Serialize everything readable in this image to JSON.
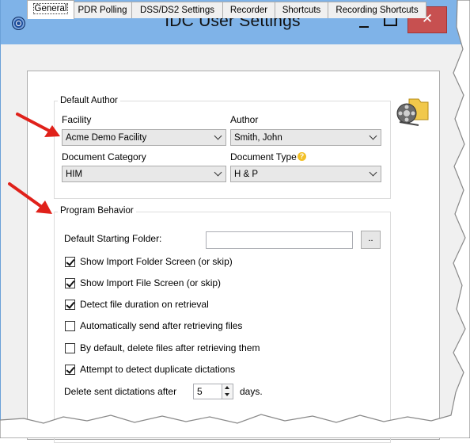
{
  "window": {
    "title": "IDC User Settings",
    "close_glyph": "✕",
    "accent_color": "#7fb3e8",
    "close_color": "#c75050"
  },
  "tabs": [
    {
      "label": "General",
      "active": true
    },
    {
      "label": "PDR Polling",
      "active": false
    },
    {
      "label": "DSS/DS2 Settings",
      "active": false
    },
    {
      "label": "Recorder",
      "active": false
    },
    {
      "label": "Shortcuts",
      "active": false
    },
    {
      "label": "Recording Shortcuts",
      "active": false
    }
  ],
  "default_author": {
    "legend": "Default Author",
    "facility_label": "Facility",
    "facility_value": "Acme Demo Facility",
    "author_label": "Author",
    "author_value": "Smith, John",
    "doc_category_label": "Document Category",
    "doc_category_value": "HIM",
    "doc_type_label": "Document Type",
    "doc_type_value": "H & P",
    "help_glyph": "?"
  },
  "program_behavior": {
    "legend": "Program Behavior",
    "starting_folder_label": "Default Starting Folder:",
    "starting_folder_value": "",
    "browse_label": "..",
    "checkboxes": [
      {
        "label": "Show Import Folder Screen (or skip)",
        "checked": true
      },
      {
        "label": "Show Import File Screen (or skip)",
        "checked": true
      },
      {
        "label": "Detect file duration on retrieval",
        "checked": true
      },
      {
        "label": "Automatically send after retrieving files",
        "checked": false
      },
      {
        "label": "By default, delete files after retrieving them",
        "checked": false
      },
      {
        "label": "Attempt to detect duplicate dictations",
        "checked": true
      }
    ],
    "delete_label": "Delete sent dictations after",
    "delete_value": "5",
    "delete_unit": "days."
  },
  "annotations": {
    "arrow_color": "#e0211a"
  }
}
